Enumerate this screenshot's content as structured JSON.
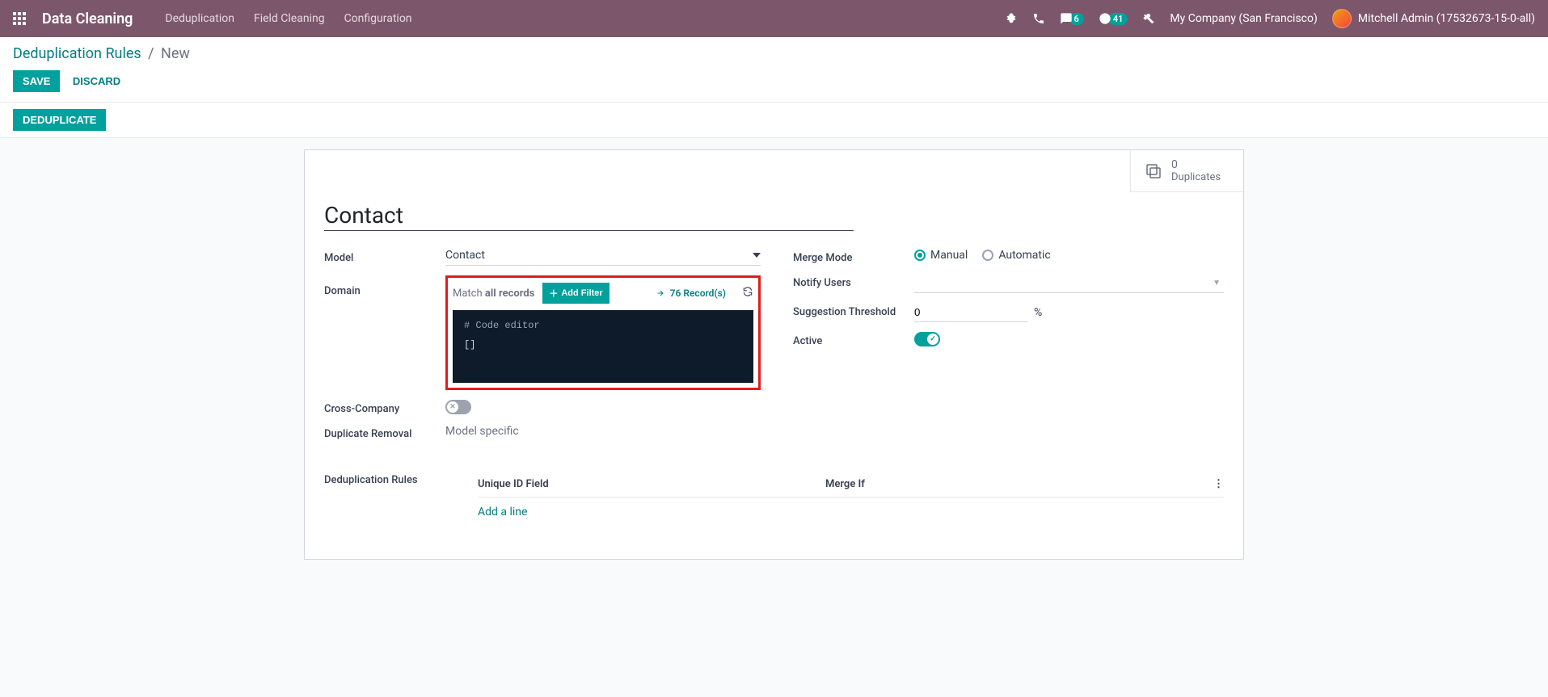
{
  "navbar": {
    "app_title": "Data Cleaning",
    "menu": [
      "Deduplication",
      "Field Cleaning",
      "Configuration"
    ],
    "messages_badge": "6",
    "activities_badge": "41",
    "company": "My Company (San Francisco)",
    "user": "Mitchell Admin (17532673-15-0-all)"
  },
  "breadcrumb": {
    "parent": "Deduplication Rules",
    "current": "New",
    "save": "Save",
    "discard": "Discard"
  },
  "statusbar": {
    "deduplicate": "Deduplicate"
  },
  "button_box": {
    "count": "0",
    "label": "Duplicates"
  },
  "form": {
    "title": "Contact",
    "labels": {
      "model": "Model",
      "domain": "Domain",
      "cross_company": "Cross-Company",
      "duplicate_removal": "Duplicate Removal",
      "merge_mode": "Merge Mode",
      "notify_users": "Notify Users",
      "suggestion_threshold": "Suggestion Threshold",
      "active": "Active",
      "dedup_rules": "Deduplication Rules"
    },
    "model_value": "Contact",
    "domain_match_prefix": "Match ",
    "domain_match_bold": "all records",
    "add_filter": "Add Filter",
    "records_count": "76 Record(s)",
    "code_comment": "# Code editor",
    "code_body": "[]",
    "duplicate_removal_value": "Model specific",
    "merge_mode_options": {
      "manual": "Manual",
      "automatic": "Automatic"
    },
    "threshold_value": "0",
    "threshold_suffix": "%",
    "rules_table": {
      "col_unique": "Unique ID Field",
      "col_merge": "Merge If",
      "add_line": "Add a line"
    }
  }
}
